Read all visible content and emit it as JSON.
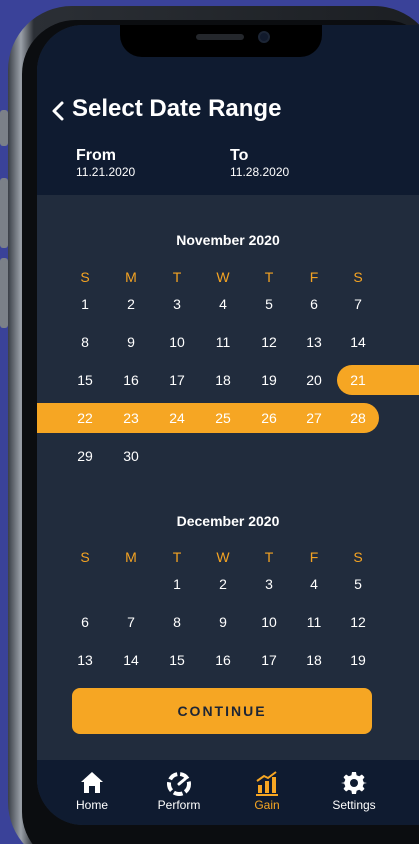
{
  "header": {
    "title": "Select Date Range",
    "from_label": "From",
    "from_date": "11.21.2020",
    "to_label": "To",
    "to_date": "11.28.2020"
  },
  "weekdays": [
    "S",
    "M",
    "T",
    "W",
    "T",
    "F",
    "S"
  ],
  "november": {
    "title": "November 2020",
    "rows": [
      [
        "1",
        "2",
        "3",
        "4",
        "5",
        "6",
        "7"
      ],
      [
        "8",
        "9",
        "10",
        "11",
        "12",
        "13",
        "14"
      ],
      [
        "15",
        "16",
        "17",
        "18",
        "19",
        "20",
        "21"
      ],
      [
        "22",
        "23",
        "24",
        "25",
        "26",
        "27",
        "28"
      ],
      [
        "29",
        "30",
        "",
        "",
        "",
        "",
        ""
      ]
    ]
  },
  "december": {
    "title": "December 2020",
    "rows": [
      [
        "",
        "",
        "1",
        "2",
        "3",
        "4",
        "5"
      ],
      [
        "6",
        "7",
        "8",
        "9",
        "10",
        "11",
        "12"
      ],
      [
        "13",
        "14",
        "15",
        "16",
        "17",
        "18",
        "19"
      ]
    ]
  },
  "continue_label": "CONTINUE",
  "tabs": [
    {
      "label": "Home",
      "icon": "home-icon"
    },
    {
      "label": "Perform",
      "icon": "gauge-icon"
    },
    {
      "label": "Gain",
      "icon": "bar-chart-icon"
    },
    {
      "label": "Settings",
      "icon": "gear-icon"
    }
  ],
  "colors": {
    "accent": "#f6a623",
    "header_bg": "#0f1b30",
    "body_bg": "#212c3d",
    "page_bg": "#3a4299"
  }
}
